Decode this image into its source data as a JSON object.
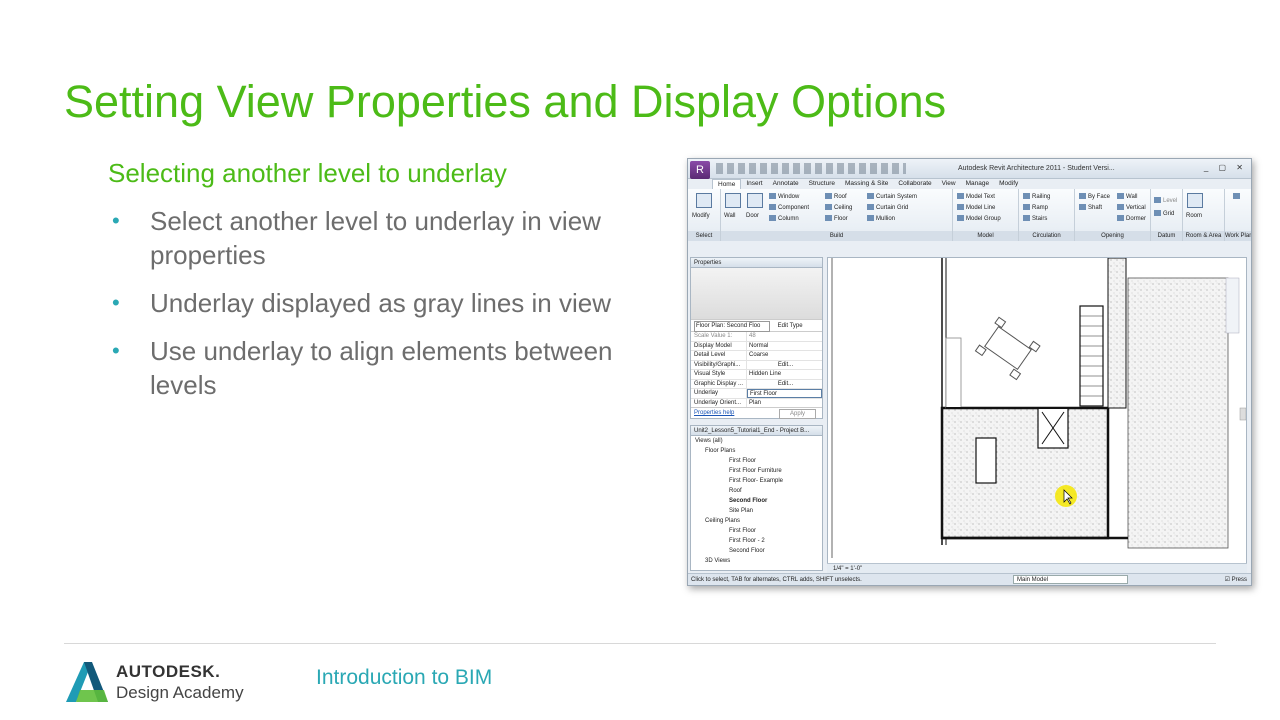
{
  "slide": {
    "title": "Setting View Properties and Display Options",
    "subtitle": "Selecting another level to underlay",
    "bullets": [
      "Select another level to underlay in view properties",
      "Underlay displayed as gray lines in view",
      "Use underlay to align elements between levels"
    ]
  },
  "footer": {
    "logo_line1": "AUTODESK.",
    "logo_line2": "Design Academy",
    "course": "Introduction to BIM"
  },
  "app": {
    "window_title": "Autodesk Revit Architecture 2011 - Student Versi...",
    "tabs": [
      "Home",
      "Insert",
      "Annotate",
      "Structure",
      "Massing & Site",
      "Collaborate",
      "View",
      "Manage",
      "Modify"
    ],
    "active_tab": "Home",
    "ribbon": {
      "select": {
        "label": "Select",
        "modify": "Modify"
      },
      "build": {
        "label": "Build",
        "items": [
          "Wall",
          "Door",
          "Window",
          "Component",
          "Column",
          "Roof",
          "Ceiling",
          "Floor",
          "Curtain System",
          "Curtain Grid",
          "Mullion"
        ]
      },
      "model": {
        "label": "Model",
        "items": [
          "Model Text",
          "Model Line",
          "Model Group"
        ]
      },
      "circulation": {
        "label": "Circulation",
        "items": [
          "Railing",
          "Ramp",
          "Stairs"
        ]
      },
      "opening": {
        "label": "Opening",
        "items": [
          "By Face",
          "Shaft",
          "Wall",
          "Vertical",
          "Dormer"
        ]
      },
      "datum": {
        "label": "Datum",
        "items": [
          "Level",
          "Grid"
        ]
      },
      "room_area": {
        "label": "Room & Area",
        "items": [
          "Room"
        ]
      },
      "work_plane": {
        "label": "Work Plane"
      }
    },
    "properties": {
      "title": "Properties",
      "selector": "Floor Plan: Second Floo",
      "edit_type": "Edit Type",
      "rows": [
        {
          "key": "Scale Value  1:",
          "value": "48"
        },
        {
          "key": "Display Model",
          "value": "Normal"
        },
        {
          "key": "Detail Level",
          "value": "Coarse"
        },
        {
          "key": "Visibility/Graphi...",
          "value": "Edit..."
        },
        {
          "key": "Visual Style",
          "value": "Hidden Line"
        },
        {
          "key": "Graphic Display ...",
          "value": "Edit..."
        },
        {
          "key": "Underlay",
          "value": "First Floor"
        },
        {
          "key": "Underlay Orient...",
          "value": "Plan"
        }
      ],
      "help_link": "Properties help",
      "apply": "Apply"
    },
    "project_browser": {
      "title": "Unit2_Lesson5_Tutorial1_End - Project B...",
      "items": [
        {
          "label": "Views (all)",
          "level": 0,
          "bold": false
        },
        {
          "label": "Floor Plans",
          "level": 1,
          "bold": false
        },
        {
          "label": "First Floor",
          "level": 2,
          "bold": false
        },
        {
          "label": "First Floor Furniture",
          "level": 2,
          "bold": false
        },
        {
          "label": "First Floor- Example",
          "level": 2,
          "bold": false
        },
        {
          "label": "Roof",
          "level": 2,
          "bold": false
        },
        {
          "label": "Second Floor",
          "level": 2,
          "bold": true
        },
        {
          "label": "Site Plan",
          "level": 2,
          "bold": false
        },
        {
          "label": "Ceiling Plans",
          "level": 1,
          "bold": false
        },
        {
          "label": "First Floor",
          "level": 2,
          "bold": false
        },
        {
          "label": "First Floor - 2",
          "level": 2,
          "bold": false
        },
        {
          "label": "Second Floor",
          "level": 2,
          "bold": false
        },
        {
          "label": "3D Views",
          "level": 1,
          "bold": false
        }
      ]
    },
    "view_scale": "1/4\" = 1'-0\"",
    "status": {
      "hint": "Click to select, TAB for alternates, CTRL adds, SHIFT unselects.",
      "model": "Main Model",
      "press": "Press"
    }
  },
  "colors": {
    "title_green": "#4cbb17",
    "accent_teal": "#2aa8b4",
    "cursor_highlight": "#f5e600"
  }
}
